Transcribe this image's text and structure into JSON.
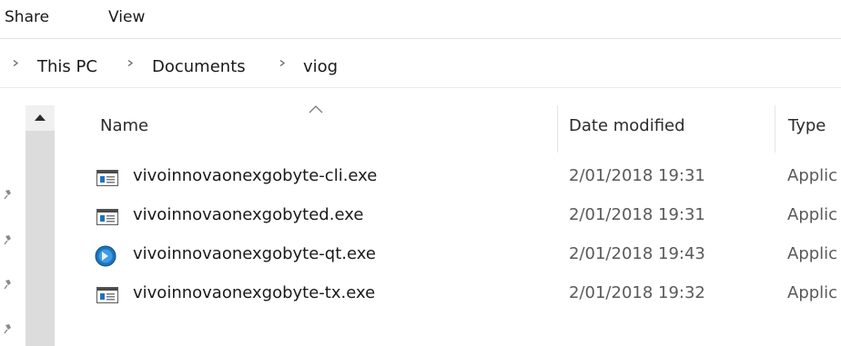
{
  "ribbon": {
    "tabs": [
      {
        "label": "Share"
      },
      {
        "label": "View"
      }
    ]
  },
  "address": {
    "crumbs": [
      "This PC",
      "Documents",
      "viog"
    ]
  },
  "columns": {
    "name": "Name",
    "date_modified": "Date modified",
    "type": "Type"
  },
  "files": [
    {
      "name": "vivoinnovaonexgobyte-cli.exe",
      "date": "2/01/2018 19:31",
      "type": "Applic",
      "icon": "exe-window-icon"
    },
    {
      "name": "vivoinnovaonexgobyted.exe",
      "date": "2/01/2018 19:31",
      "type": "Applic",
      "icon": "exe-window-icon"
    },
    {
      "name": "vivoinnovaonexgobyte-qt.exe",
      "date": "2/01/2018 19:43",
      "type": "Applic",
      "icon": "app-logo-icon"
    },
    {
      "name": "vivoinnovaonexgobyte-tx.exe",
      "date": "2/01/2018 19:32",
      "type": "Applic",
      "icon": "exe-window-icon"
    }
  ],
  "colors": {
    "accent_blue": "#1e73be",
    "scroll_track": "#dcdcdc"
  }
}
